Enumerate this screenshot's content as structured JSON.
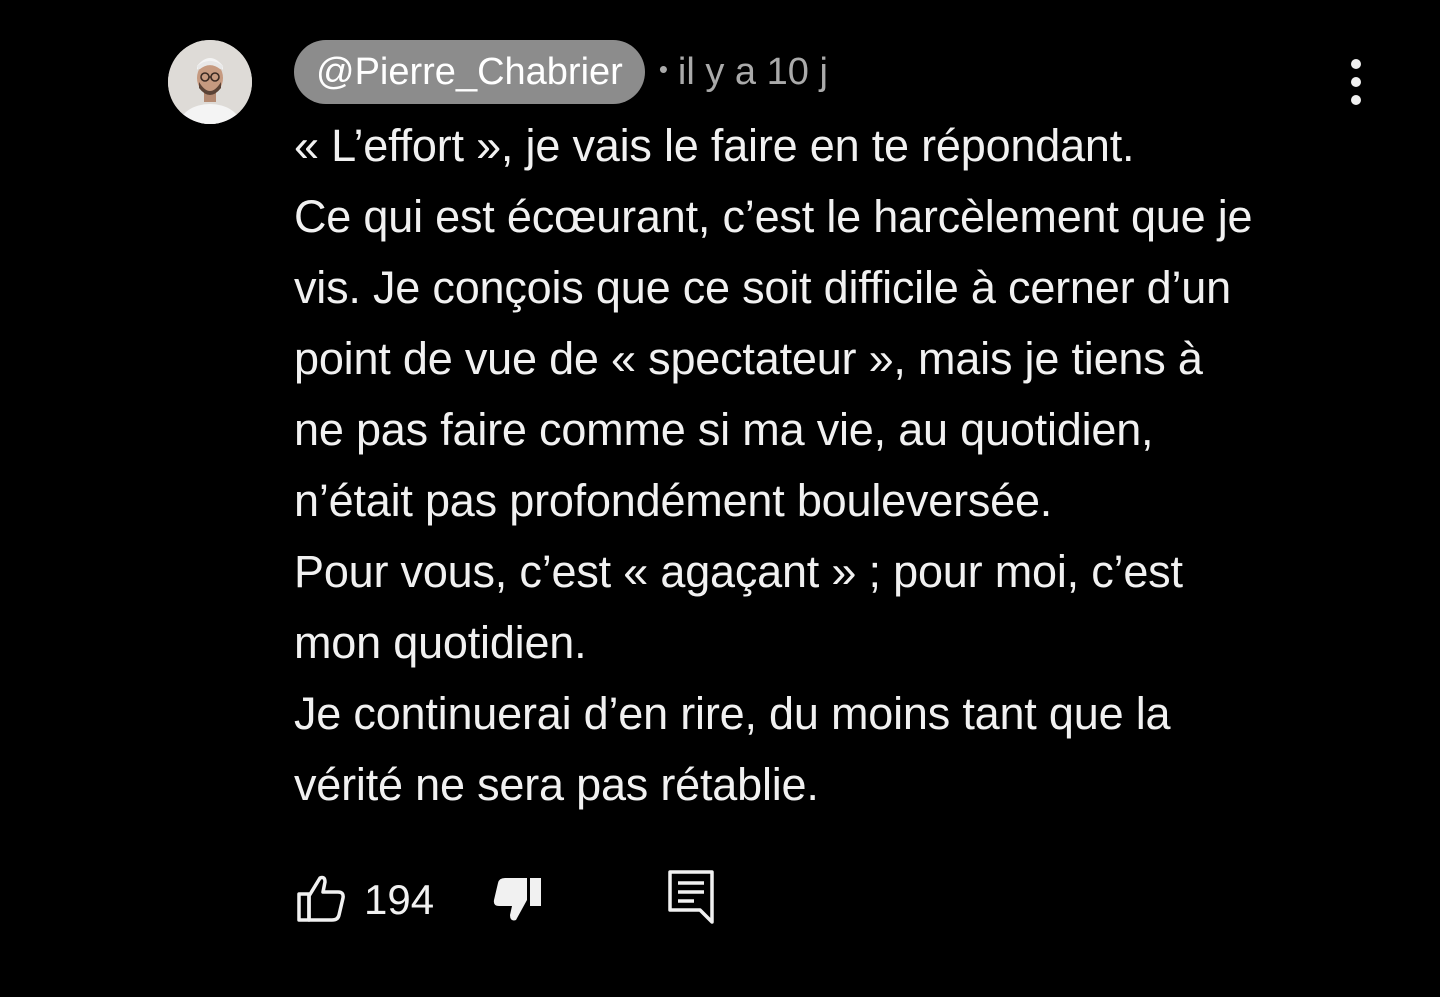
{
  "comment": {
    "author": "@Pierre_Chabrier",
    "separator": "•",
    "timestamp": "il y a 10 j",
    "text_lines": [
      "« L’effort », je vais le faire en te répondant.",
      "Ce qui est écœurant, c’est le harcèlement que je",
      "vis. Je conçois que ce soit difficile à cerner d’un",
      "point de vue de « spectateur », mais je tiens à",
      "ne pas faire comme si ma vie, au quotidien,",
      "n’était pas profondément bouleversée.",
      "Pour vous, c’est « agaçant » ; pour moi, c’est",
      "mon quotidien.",
      "Je continuerai d’en rire, du moins tant que la",
      "vérité ne sera pas rétablie."
    ],
    "like_count": "194"
  },
  "icons": {
    "menu": "more-vert-icon",
    "like": "thumb-up-outline-icon",
    "dislike": "thumb-down-filled-icon",
    "reply": "comment-reply-icon"
  },
  "colors": {
    "background": "#000000",
    "text": "#f1f1f1",
    "meta": "#aaaaaa",
    "author_chip": "#8c8c8c"
  }
}
